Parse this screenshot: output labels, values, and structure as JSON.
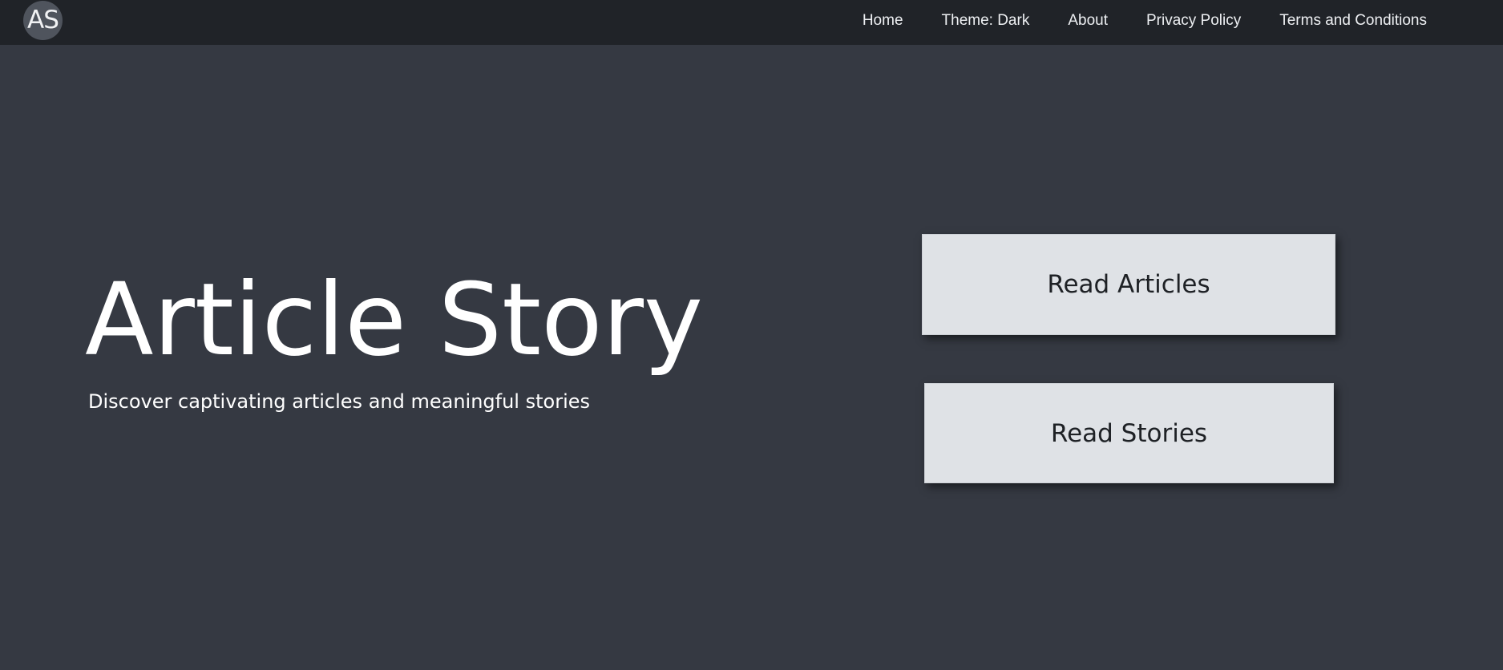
{
  "navbar": {
    "logo_text": "AS",
    "links": [
      {
        "label": "Home"
      },
      {
        "label": "Theme: Dark"
      },
      {
        "label": "About"
      },
      {
        "label": "Privacy Policy"
      },
      {
        "label": "Terms and Conditions"
      }
    ]
  },
  "hero": {
    "title": "Article Story",
    "subtitle": "Discover captivating articles and meaningful stories"
  },
  "actions": {
    "read_articles": "Read Articles",
    "read_stories": "Read Stories"
  },
  "colors": {
    "background": "#353942",
    "navbar": "#202328",
    "button": "#dfe2e6",
    "text_light": "#ffffff"
  }
}
